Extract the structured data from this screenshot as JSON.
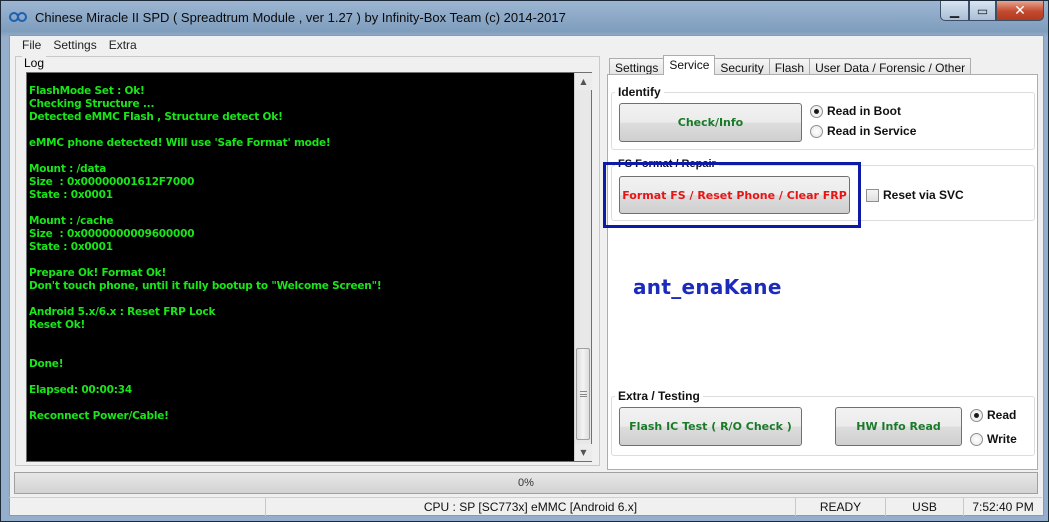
{
  "window": {
    "title": "Chinese Miracle II SPD ( Spreadtrum Module , ver 1.27 ) by Infinity-Box Team (c) 2014-2017"
  },
  "menu": [
    "File",
    "Settings",
    "Extra"
  ],
  "log": {
    "label": "Log",
    "lines": [
      "FlashMode Set : Ok!",
      "Checking Structure ...",
      "Detected eMMC Flash , Structure detect Ok!",
      "",
      "eMMC phone detected! Will use 'Safe Format' mode!",
      "",
      "Mount : /data",
      "Size  : 0x00000001612F7000",
      "State : 0x0001",
      "",
      "Mount : /cache",
      "Size  : 0x0000000009600000",
      "State : 0x0001",
      "",
      "Prepare Ok! Format Ok!",
      "Don't touch phone, until it fully bootup to \"Welcome Screen\"!",
      "",
      "Android 5.x/6.x : Reset FRP Lock",
      "Reset Ok!",
      "",
      "",
      "Done!",
      "",
      "Elapsed: 00:00:34",
      "",
      "Reconnect Power/Cable!"
    ],
    "text_color": "#19e619"
  },
  "tabs": [
    {
      "label": "Settings"
    },
    {
      "label": "Service"
    },
    {
      "label": "Security"
    },
    {
      "label": "Flash"
    },
    {
      "label": "User Data / Forensic / Other"
    }
  ],
  "active_tab": "Service",
  "identify": {
    "label": "Identify",
    "button": "Check/Info",
    "radio_boot": "Read in Boot",
    "radio_service": "Read in Service",
    "selected": "Read in Boot"
  },
  "fs_format": {
    "label": "FS Format / Repair",
    "button": "Format FS / Reset Phone / Clear FRP",
    "checkbox_label": "Reset via SVC",
    "checkbox_checked": false
  },
  "watermark": "ant_enaKane",
  "extra": {
    "label": "Extra / Testing",
    "flash_ic_button": "Flash IC Test ( R/O Check )",
    "hw_info_button": "HW Info Read",
    "radio_read": "Read",
    "radio_write": "Write",
    "selected": "Read"
  },
  "progress": {
    "value": 0,
    "text": "0%"
  },
  "statusbar": {
    "cpu": "CPU : SP [SC773x] eMMC [Android 6.x]",
    "state": "READY",
    "port": "USB",
    "time": "7:52:40 PM"
  },
  "colors": {
    "green_button_text": "#1b7a2a",
    "red_button_text": "#e81414",
    "highlight_border": "#0d1aa8",
    "watermark": "#1d2bbd"
  }
}
